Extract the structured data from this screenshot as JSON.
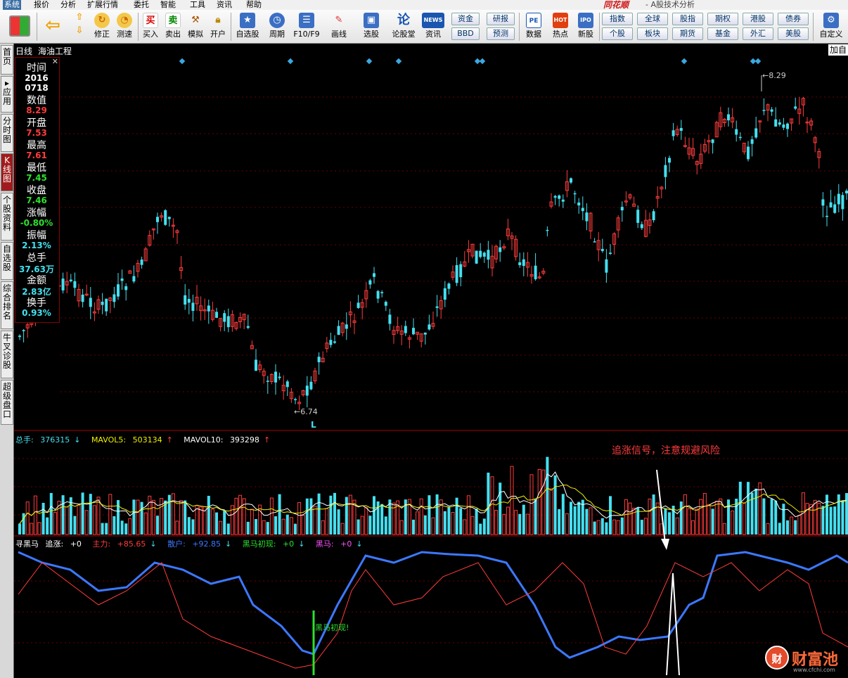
{
  "menu": {
    "items": [
      "系统",
      "报价",
      "分析",
      "扩展行情",
      "委托",
      "智能",
      "工具",
      "资讯",
      "帮助"
    ],
    "brand": "同花顺",
    "subtitle": "- A股技术分析"
  },
  "toolbar": {
    "buttons": [
      {
        "label": "修正",
        "icon": "refresh-icon"
      },
      {
        "label": "测速",
        "icon": "speed-icon"
      },
      {
        "label": "买入",
        "icon": "buy-icon"
      },
      {
        "label": "卖出",
        "icon": "sell-icon"
      },
      {
        "label": "模拟",
        "icon": "hammer-icon"
      },
      {
        "label": "开户",
        "icon": "lock-icon"
      },
      {
        "label": "自选股",
        "icon": "star-icon"
      },
      {
        "label": "周期",
        "icon": "clock-icon"
      },
      {
        "label": "F10/F9",
        "icon": "f10-icon"
      },
      {
        "label": "画线",
        "icon": "pen-icon"
      },
      {
        "label": "选股",
        "icon": "monitor-icon"
      },
      {
        "label": "论股堂",
        "icon": "forum-icon"
      },
      {
        "label": "资讯",
        "icon": "news-icon"
      },
      {
        "label": "数据",
        "icon": "pe-icon"
      },
      {
        "label": "热点",
        "icon": "hot-icon"
      },
      {
        "label": "新股",
        "icon": "ipo-icon"
      },
      {
        "label": "自定义",
        "icon": "custom-icon"
      }
    ],
    "small_buttons": [
      "资金",
      "研报",
      "BBD",
      "预测",
      "指数",
      "全球",
      "股指",
      "期权",
      "港股",
      "债券",
      "个股",
      "板块",
      "期货",
      "基金",
      "外汇",
      "美股"
    ],
    "icon_text": {
      "buy": "买",
      "sell": "卖",
      "forum": "论",
      "news": "NEWS",
      "pe": "PE",
      "hot": "HOT",
      "ipo": "IPO"
    }
  },
  "sidetabs": [
    "首页",
    "应用",
    "分时图",
    "K线图",
    "个股资料",
    "自选股",
    "综合排名",
    "牛叉诊股",
    "超级盘口"
  ],
  "chart": {
    "period": "日线",
    "stock_name": "海油工程",
    "add_button": "加自",
    "high_label": "8.29",
    "low_label": "6.74",
    "low_marker": "L",
    "colors": {
      "up": "#ff3c3c",
      "down": "#44e0f0",
      "ma5": "#ffffff",
      "ma10": "#f0f000",
      "retail": "#3c78ff",
      "main": "#ff3c3c",
      "signal": "#2de02d"
    }
  },
  "info": [
    {
      "k": "时间",
      "v": "2016",
      "v2": "0718",
      "c": "white"
    },
    {
      "k": "数值",
      "v": "8.29",
      "c": "red"
    },
    {
      "k": "开盘",
      "v": "7.53",
      "c": "red"
    },
    {
      "k": "最高",
      "v": "7.61",
      "c": "red"
    },
    {
      "k": "最低",
      "v": "7.45",
      "c": "green"
    },
    {
      "k": "收盘",
      "v": "7.46",
      "c": "green"
    },
    {
      "k": "涨幅",
      "v": "-0.80%",
      "c": "green"
    },
    {
      "k": "振幅",
      "v": "2.13%",
      "c": "cyan"
    },
    {
      "k": "总手",
      "v": "37.63万",
      "c": "cyan"
    },
    {
      "k": "金额",
      "v": "2.83亿",
      "c": "cyan"
    },
    {
      "k": "换手",
      "v": "0.93%",
      "c": "cyan"
    }
  ],
  "volume": {
    "label": "总手:",
    "value": "376315",
    "value_dir": "↓",
    "ma5_label": "MAVOL5:",
    "ma5": "503134",
    "ma5_dir": "↑",
    "ma10_label": "MAVOL10:",
    "ma10": "393298",
    "ma10_dir": "↑"
  },
  "indicator": {
    "name": "寻黑马",
    "zz_label": "追涨:",
    "zz": "+0",
    "main_label": "主力:",
    "main": "+85.65",
    "main_dir": "↓",
    "retail_label": "散户:",
    "retail": "+92.85",
    "retail_dir": "↓",
    "bm1_label": "黑马初现:",
    "bm1": "+0",
    "bm1_dir": "↓",
    "bm_label": "黑马:",
    "bm": "+0",
    "bm_dir": "↓"
  },
  "annotations": {
    "chase_signal": "追涨信号，注意规避风险",
    "dark_horse": "黑马初现!"
  },
  "watermark": {
    "logo": "财",
    "name": "财富池",
    "url": "www.cfchi.com"
  }
}
